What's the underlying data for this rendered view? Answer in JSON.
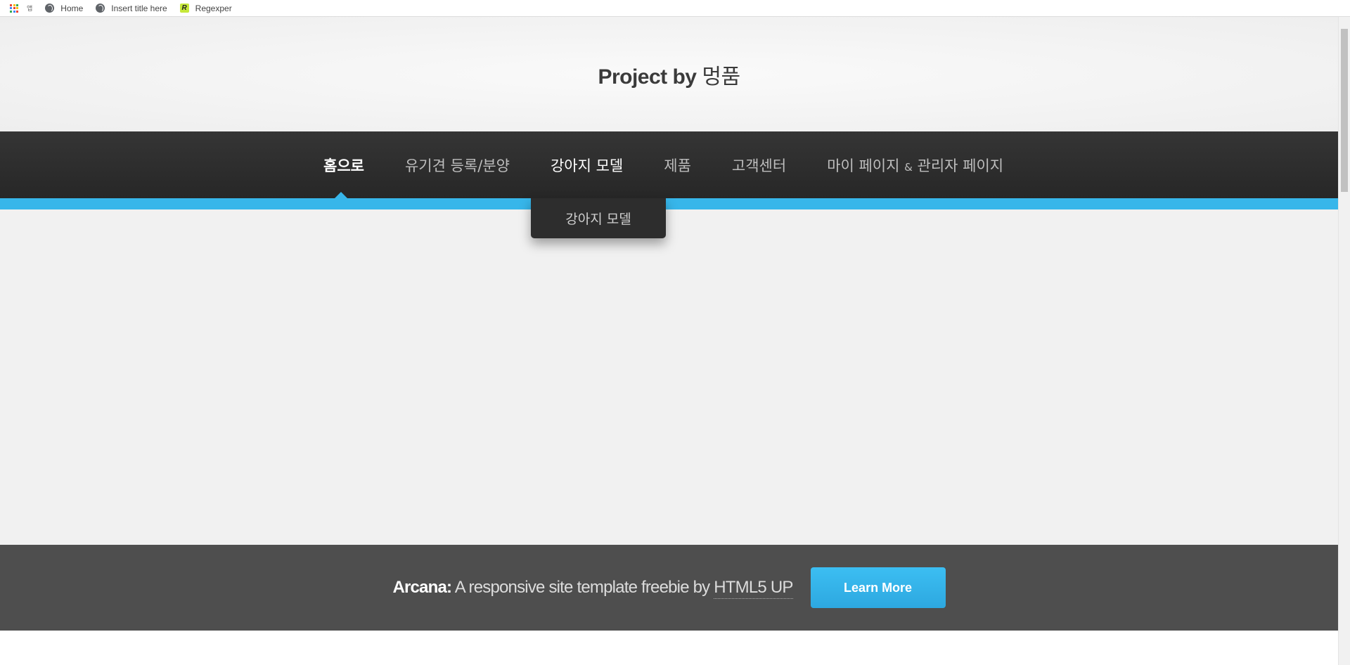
{
  "bookmarks": {
    "apps_colors": [
      "#ea4335",
      "#fbbc05",
      "#34a853",
      "#4285f4",
      "#ea4335",
      "#fbbc05",
      "#34a853",
      "#4285f4",
      "#ea4335"
    ],
    "small_item": "앱",
    "items": [
      {
        "label": "Home",
        "icon": "globe-icon"
      },
      {
        "label": "Insert title here",
        "icon": "globe-icon"
      },
      {
        "label": "Regexper",
        "icon": "regexper-icon",
        "icon_text": "R"
      }
    ]
  },
  "header": {
    "title_en": "Project by",
    "title_kr": "멍품"
  },
  "nav": {
    "items": [
      {
        "label": "홈으로",
        "state": "active"
      },
      {
        "label": "유기견 등록/분양",
        "state": "normal"
      },
      {
        "label": "강아지 모델",
        "state": "hover"
      },
      {
        "label": "제품",
        "state": "normal"
      },
      {
        "label": "고객센터",
        "state": "normal"
      }
    ],
    "last_item": {
      "part1": "마이 페이지",
      "amp": "&",
      "part2": "관리자 페이지"
    },
    "dropdown_item": "강아지 모델",
    "accent_color": "#37b6ea"
  },
  "cta": {
    "brand": "Arcana:",
    "text": "A responsive site template freebie by",
    "link": "HTML5 UP",
    "button": "Learn More"
  }
}
